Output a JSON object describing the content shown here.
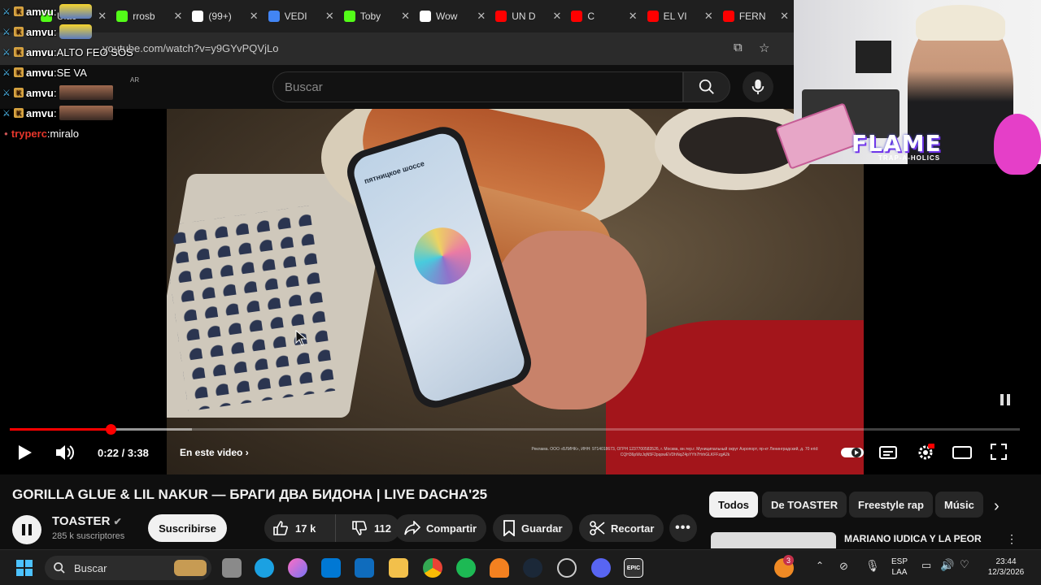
{
  "browser": {
    "tabs": [
      {
        "label": "Ulac",
        "icon": "kick-icon",
        "color": "#53fc18"
      },
      {
        "label": "rrosb",
        "icon": "kick-icon",
        "color": "#53fc18"
      },
      {
        "label": "(99+)",
        "icon": "tiktok-icon",
        "color": "#ffffff"
      },
      {
        "label": "VEDI",
        "icon": "google-icon",
        "color": "#4285f4"
      },
      {
        "label": "Toby",
        "icon": "kick-icon",
        "color": "#53fc18"
      },
      {
        "label": "Wow",
        "icon": "app-icon",
        "color": "#ffffff"
      },
      {
        "label": "UN D",
        "icon": "youtube-icon",
        "color": "#ff0000"
      },
      {
        "label": "C",
        "icon": "youtube-icon",
        "color": "#ff0000"
      },
      {
        "label": "EL VI",
        "icon": "youtube-icon",
        "color": "#ff0000"
      },
      {
        "label": "FERN",
        "icon": "youtube-icon",
        "color": "#ff0000"
      }
    ],
    "url": "youtube.com/watch?v=y9GYvPQVjLo"
  },
  "youtube": {
    "search_placeholder": "Buscar",
    "country": "AR",
    "player": {
      "time": "0:22 / 3:38",
      "progress_fraction": 0.1,
      "buffer_fraction": 0.18,
      "chapters_label": "En este video",
      "legal_text": "Реклама. ООО «БЛИНК», ИНН: 9714018673, ОГРН 1237700583526, г. Москва, вн.тер.г. Муниципальный округ Аэропорт, пр-кт Ленинградский, д. 70 erid: CQH36pWzJqN5F2pqowEVDhNqZ4pYYh7HrhGLKFFzgA2k",
      "phone_title": "пятницкое шоссе"
    },
    "video_title": "GORILLA GLUE & LIL NAKUR — БРАГИ ДВА БИДОНА | LIVE DACHA'25",
    "channel": {
      "name": "TOASTER",
      "subscribers": "285 k suscriptores",
      "subscribe_label": "Suscribirse"
    },
    "actions": {
      "likes": "17 k",
      "dislikes": "112",
      "share": "Compartir",
      "save": "Guardar",
      "clip": "Recortar"
    },
    "chips": [
      "Todos",
      "De TOASTER",
      "Freestyle rap",
      "Músic"
    ],
    "recommendation_title": "MARIANO IUDICA Y LA PEOR"
  },
  "chat": [
    {
      "user": "amvu",
      "message": ""
    },
    {
      "user": "amvu",
      "message": ""
    },
    {
      "user": "amvu",
      "message": "ALTO FEO SOS"
    },
    {
      "user": "amvu",
      "message": "SE VA"
    },
    {
      "user": "amvu",
      "message": ""
    },
    {
      "user": "amvu",
      "message": ""
    },
    {
      "user": "tryperc",
      "message": "miralo"
    }
  ],
  "overlay": {
    "logo_text": "FLAME",
    "logo_sub": "TRAP-A-HOLICS"
  },
  "taskbar": {
    "search_label": "Buscar",
    "language": "ESP",
    "layout": "LAA",
    "time": "23:44",
    "date": "12/3/2026",
    "notification_count": "3"
  }
}
